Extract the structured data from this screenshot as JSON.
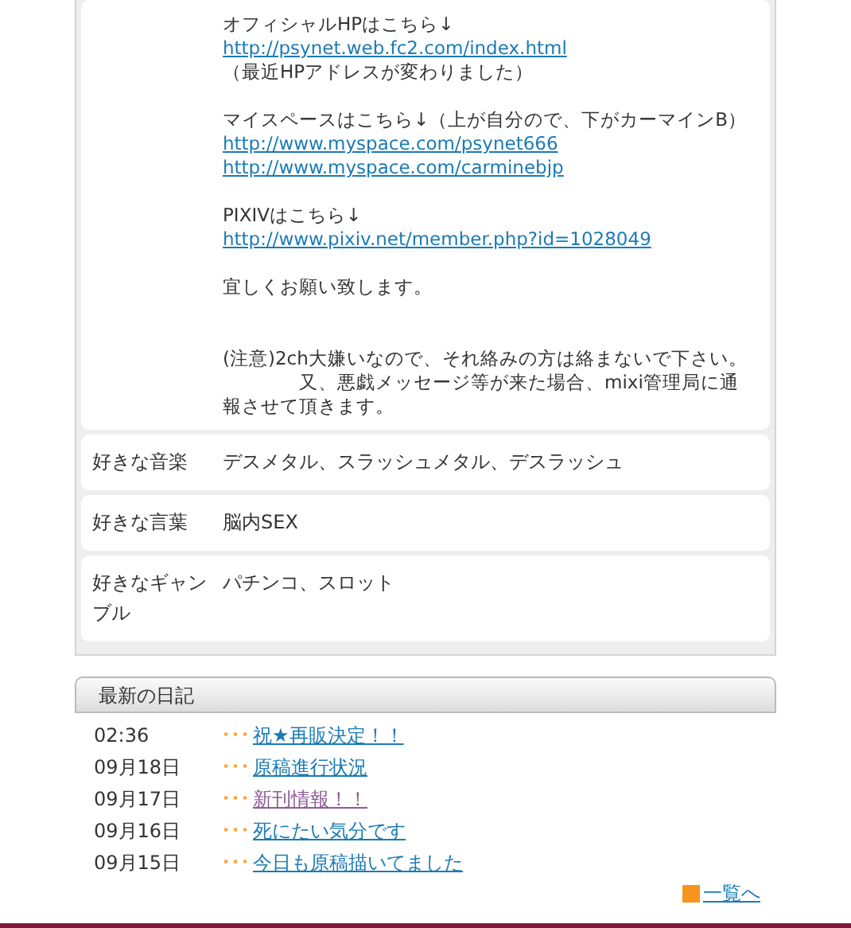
{
  "profile": {
    "description": [
      {
        "kind": "text",
        "text": "オフィシャルHPはこちら↓"
      },
      {
        "kind": "link",
        "text": "http://psynet.web.fc2.com/index.html"
      },
      {
        "kind": "text",
        "text": "（最近HPアドレスが変わりました）"
      },
      {
        "kind": "break"
      },
      {
        "kind": "text",
        "text": "マイスペースはこちら↓（上が自分ので、下がカーマインB）"
      },
      {
        "kind": "link",
        "text": "http://www.myspace.com/psynet666"
      },
      {
        "kind": "link",
        "text": "http://www.myspace.com/carminebjp"
      },
      {
        "kind": "break"
      },
      {
        "kind": "text",
        "text": "PIXIVはこちら↓"
      },
      {
        "kind": "link",
        "text": "http://www.pixiv.net/member.php?id=1028049"
      },
      {
        "kind": "break"
      },
      {
        "kind": "text",
        "text": "宜しくお願い致します。"
      },
      {
        "kind": "break"
      },
      {
        "kind": "break"
      },
      {
        "kind": "text",
        "text": "(注意)2ch大嫌いなので、それ絡みの方は絡まないで下さい。"
      },
      {
        "kind": "text",
        "text": "　　　　又、悪戯メッセージ等が来た場合、mixi管理局に通報させて頂きます。"
      }
    ],
    "rows": [
      {
        "label": "好きな音楽",
        "value": "デスメタル、スラッシュメタル、デスラッシュ"
      },
      {
        "label": "好きな言葉",
        "value": "脳内SEX"
      },
      {
        "label": "好きなギャンブル",
        "value": "パチンコ、スロット"
      }
    ]
  },
  "diary": {
    "title": "最新の日記",
    "entries": [
      {
        "date": "02:36",
        "marker": "･･･",
        "title": "祝★再販決定！！",
        "visited": false
      },
      {
        "date": "09月18日",
        "marker": "･･･",
        "title": "原稿進行状況",
        "visited": false
      },
      {
        "date": "09月17日",
        "marker": "･･･",
        "title": "新刊情報！！",
        "visited": true
      },
      {
        "date": "09月16日",
        "marker": "･･･",
        "title": "死にたい気分です",
        "visited": false
      },
      {
        "date": "09月15日",
        "marker": "･･･",
        "title": "今日も原稿描いてました",
        "visited": false
      }
    ],
    "more_link": "一覧へ"
  }
}
